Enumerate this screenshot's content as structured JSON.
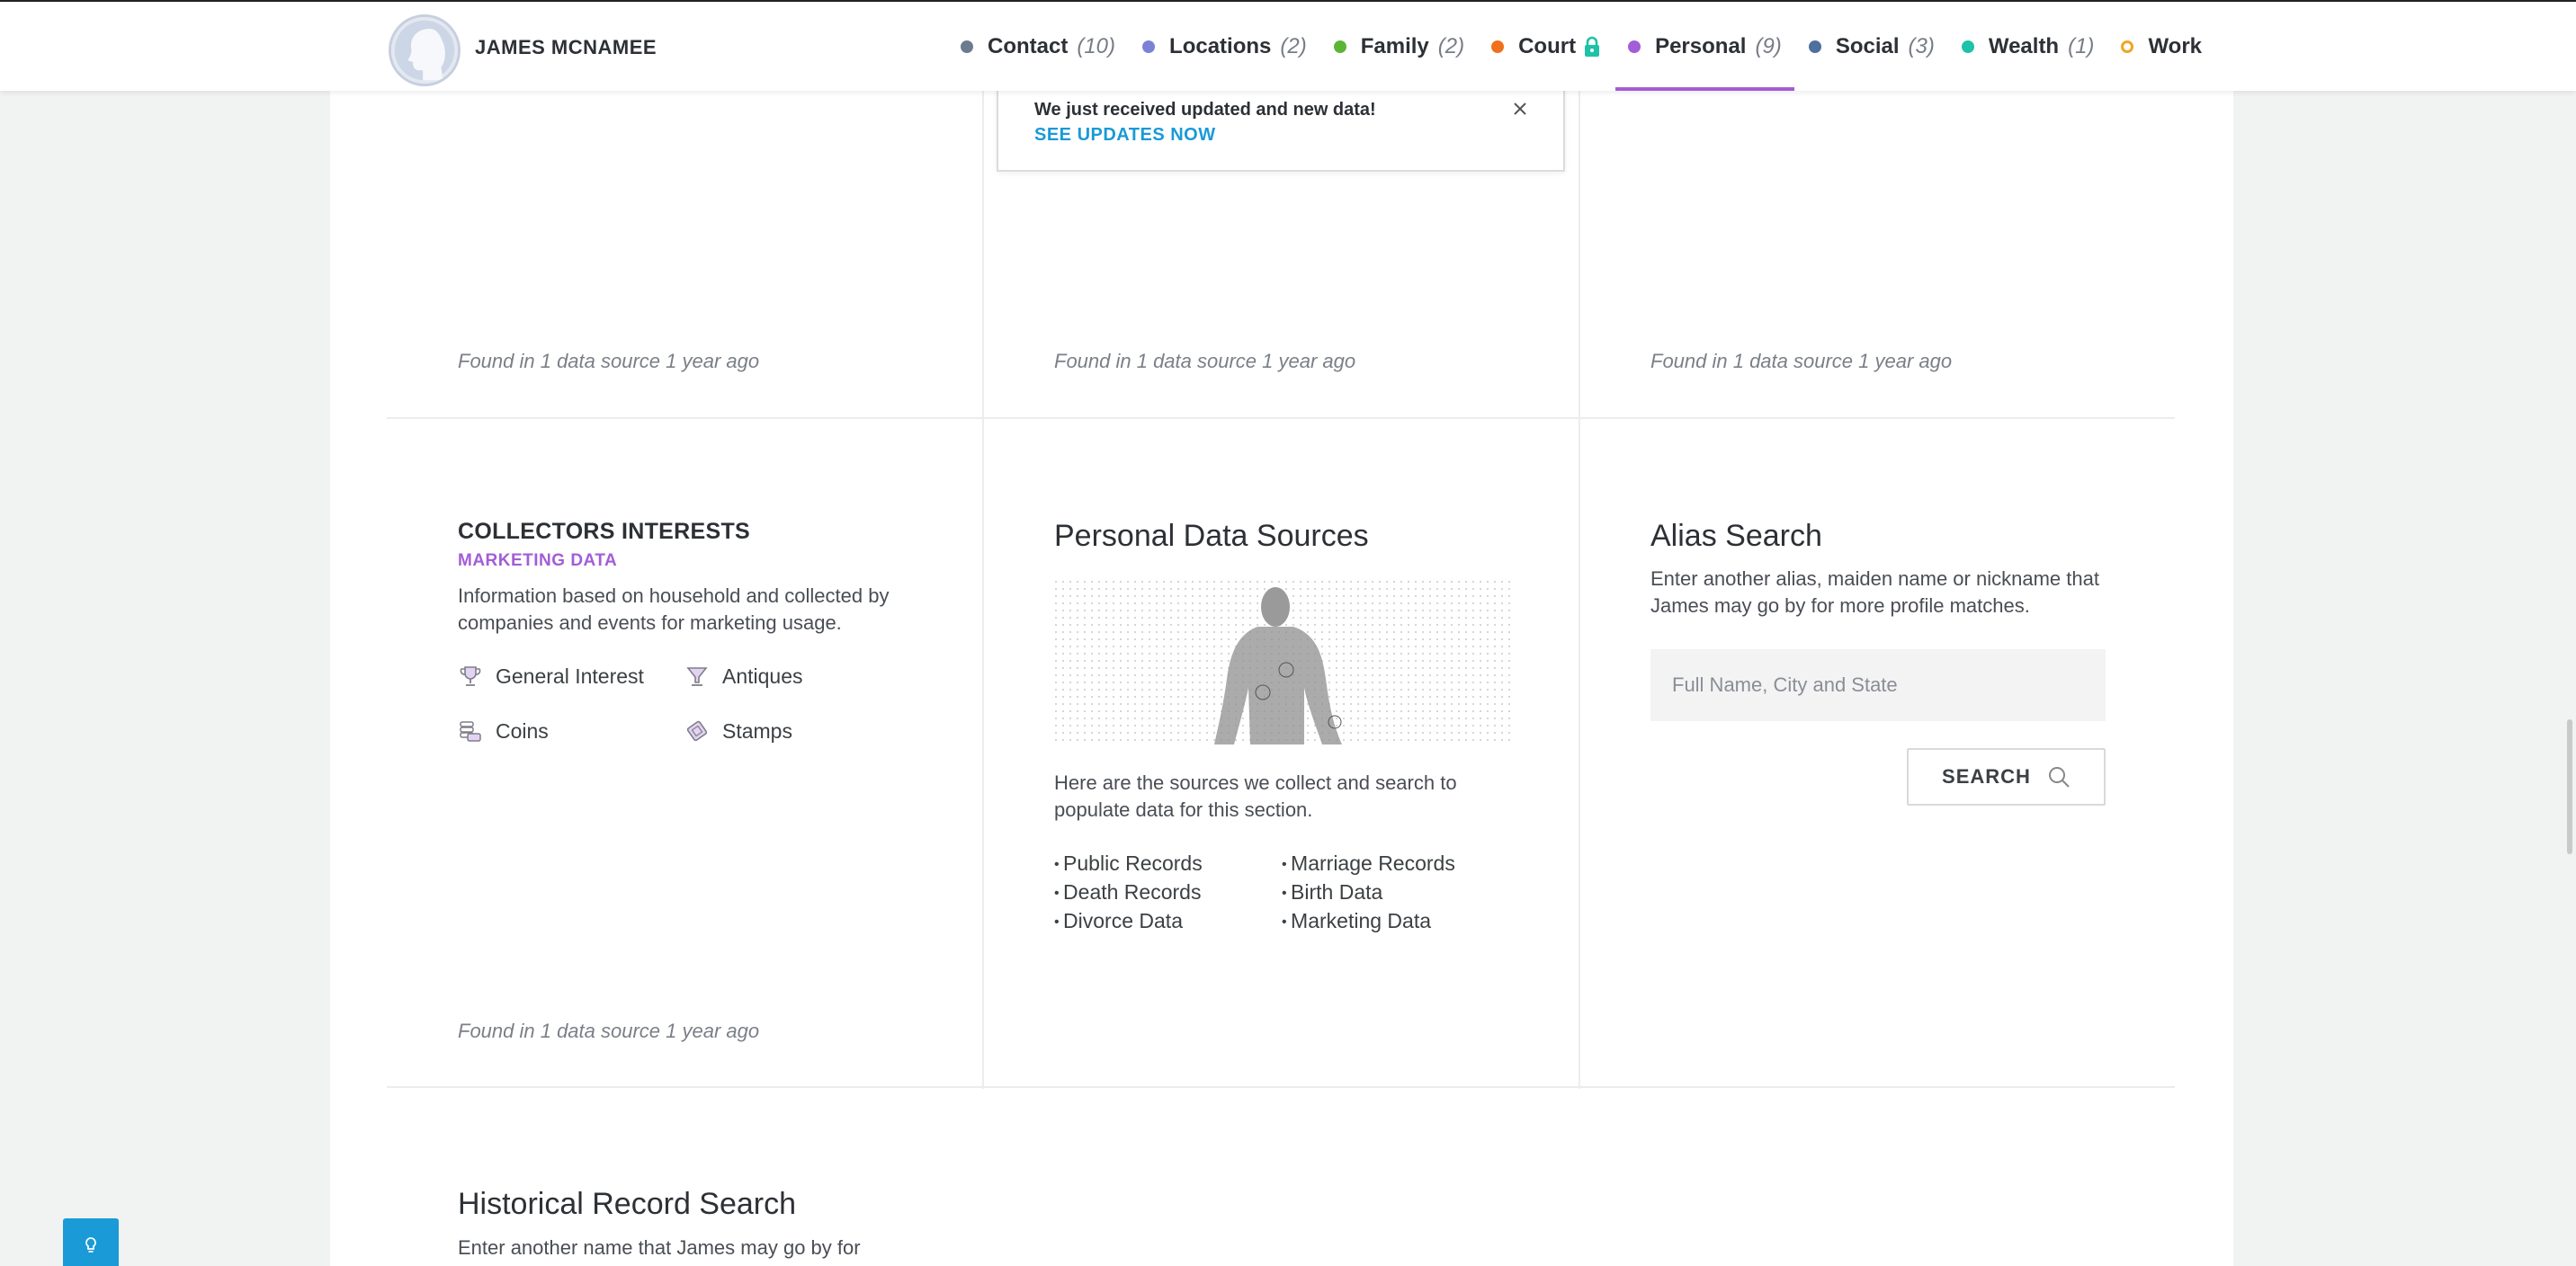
{
  "profile": {
    "name": "JAMES MCNAMEE"
  },
  "nav": [
    {
      "label": "Contact",
      "count": "(10)",
      "color": "#6d7b8f"
    },
    {
      "label": "Locations",
      "count": "(2)",
      "color": "#7b82d6"
    },
    {
      "label": "Family",
      "count": "(2)",
      "color": "#5bb536"
    },
    {
      "label": "Court",
      "count": "",
      "color": "#f0701e",
      "icon": "lock-icon"
    },
    {
      "label": "Personal",
      "count": "(9)",
      "color": "#a35dd6",
      "active": true
    },
    {
      "label": "Social",
      "count": "(3)",
      "color": "#4f6f9f"
    },
    {
      "label": "Wealth",
      "count": "(1)",
      "color": "#1ec2a8"
    },
    {
      "label": "Work",
      "count": "",
      "color": "#f0a524",
      "ring": true
    }
  ],
  "notification": {
    "message": "We just received updated and new data!",
    "link": "SEE UPDATES NOW",
    "close_icon": "close-icon"
  },
  "top_row": {
    "found": [
      "Found in 1 data source 1 year ago",
      "Found in 1 data source 1 year ago",
      "Found in 1 data source 1 year ago"
    ]
  },
  "collectors": {
    "title": "COLLECTORS INTERESTS",
    "subtitle": "MARKETING DATA",
    "description": "Information based on household and collected by companies and events for marketing usage.",
    "items": [
      {
        "label": "General Interest",
        "icon": "trophy-icon"
      },
      {
        "label": "Antiques",
        "icon": "vase-icon"
      },
      {
        "label": "Coins",
        "icon": "coins-icon"
      },
      {
        "label": "Stamps",
        "icon": "stamp-icon"
      }
    ],
    "found": "Found in 1 data source 1 year ago"
  },
  "data_sources": {
    "title": "Personal Data Sources",
    "description": "Here are the sources we collect and search to populate data for this section.",
    "col1": [
      "Public Records",
      "Death Records",
      "Divorce Data"
    ],
    "col2": [
      "Marriage Records",
      "Birth Data",
      "Marketing Data"
    ]
  },
  "alias_search": {
    "title": "Alias Search",
    "description": "Enter another alias, maiden name or nickname that James may go by for more profile matches.",
    "placeholder": "Full Name, City and State",
    "button": "SEARCH",
    "button_icon": "search-icon"
  },
  "historical": {
    "title": "Historical Record Search",
    "description": "Enter another name that James may go by for"
  },
  "help": {
    "icon": "lightbulb-icon"
  }
}
